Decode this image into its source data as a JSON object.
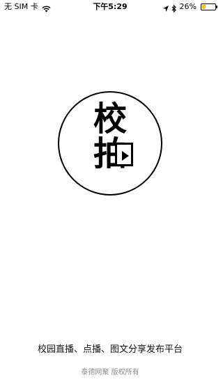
{
  "status_bar": {
    "carrier": "无 SIM 卡",
    "time": "下午5:29",
    "battery_percent": "26%",
    "battery_level": 0.26,
    "battery_color": "#f5c518",
    "icons": [
      "wifi-icon",
      "location-arrow-icon",
      "bluetooth-icon",
      "battery-icon"
    ]
  },
  "logo": {
    "char_top": "校",
    "char_bottom": "拍",
    "icon": "film-play-icon"
  },
  "tagline": "校园直播、点播、图文分享发布平台",
  "copyright": "泰德网聚 版权所有"
}
